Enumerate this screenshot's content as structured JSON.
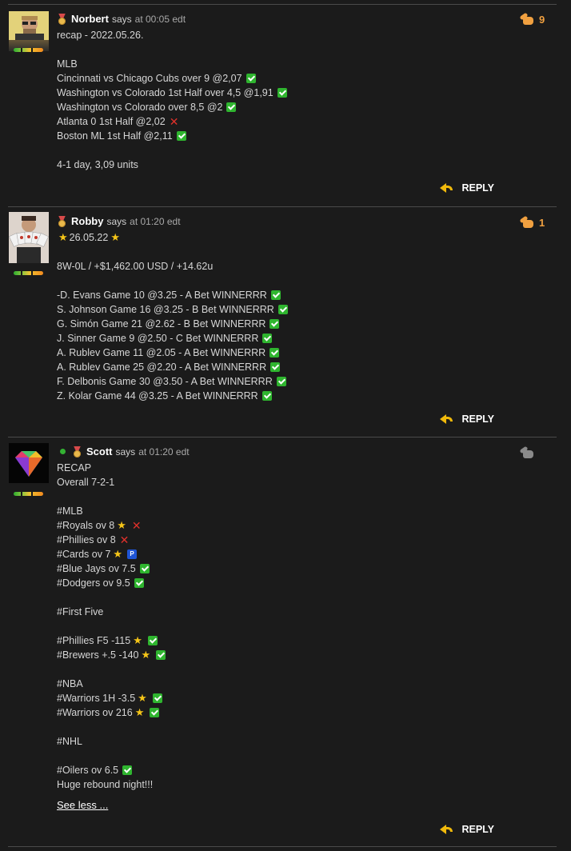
{
  "reply_label": "REPLY",
  "comments": [
    {
      "author": "Norbert",
      "says": "says",
      "time": "at 00:05 edt",
      "likes": "9",
      "lines": [
        {
          "t": "recap - 2022.05.26."
        },
        {
          "t": ""
        },
        {
          "t": "MLB"
        },
        {
          "t": "Cincinnati vs Chicago Cubs over 9 @2,07",
          "m": "check"
        },
        {
          "t": "Washington vs Colorado 1st Half over 4,5 @1,91",
          "m": "check"
        },
        {
          "t": "Washington vs Colorado over 8,5 @2",
          "m": "check"
        },
        {
          "t": "Atlanta 0 1st Half @2,02",
          "m": "cross"
        },
        {
          "t": "Boston ML 1st Half @2,11",
          "m": "check"
        },
        {
          "t": ""
        },
        {
          "t": "4-1 day, 3,09 units"
        }
      ]
    },
    {
      "author": "Robby",
      "says": "says",
      "time": "at 01:20 edt",
      "likes": "1",
      "lines": [
        {
          "t": "26.05.22",
          "m": "starwrap"
        },
        {
          "t": ""
        },
        {
          "t": "8W-0L / +$1,462.00 USD / +14.62u"
        },
        {
          "t": ""
        },
        {
          "t": "-D. Evans Game 10 @3.25 - A Bet WINNERRR",
          "m": "check"
        },
        {
          "t": "S. Johnson Game 16 @3.25 - B Bet WINNERRR",
          "m": "check"
        },
        {
          "t": "G. Simón Game 21 @2.62 - B Bet WINNERRR",
          "m": "check"
        },
        {
          "t": "J. Sinner Game 9 @2.50 - C Bet WINNERRR",
          "m": "check"
        },
        {
          "t": "A. Rublev Game 11 @2.05 - A Bet WINNERRR",
          "m": "check"
        },
        {
          "t": "A. Rublev Game 25 @2.20 - A Bet WINNERRR",
          "m": "check"
        },
        {
          "t": "F. Delbonis Game 30 @3.50 - A Bet WINNERRR",
          "m": "check"
        },
        {
          "t": "Z. Kolar Game 44 @3.25 - A Bet WINNERRR",
          "m": "check"
        }
      ]
    },
    {
      "author": "Scott",
      "says": "says",
      "time": "at 01:20 edt",
      "likes": "",
      "see_less": "See less ...",
      "lines": [
        {
          "t": "RECAP"
        },
        {
          "t": "Overall 7-2-1"
        },
        {
          "t": ""
        },
        {
          "t": "#MLB"
        },
        {
          "t": "#Royals ov 8",
          "m": "star-cross"
        },
        {
          "t": "#Phillies ov 8",
          "m": "cross"
        },
        {
          "t": "#Cards ov 7",
          "m": "star-p"
        },
        {
          "t": "#Blue Jays ov 7.5",
          "m": "check"
        },
        {
          "t": "#Dodgers ov 9.5",
          "m": "check"
        },
        {
          "t": ""
        },
        {
          "t": "#First Five"
        },
        {
          "t": ""
        },
        {
          "t": "#Phillies F5 -115",
          "m": "star-check"
        },
        {
          "t": "#Brewers +.5 -140",
          "m": "star-check"
        },
        {
          "t": ""
        },
        {
          "t": "#NBA"
        },
        {
          "t": "#Warriors 1H -3.5",
          "m": "star-check"
        },
        {
          "t": "#Warriors ov 216",
          "m": "star-check"
        },
        {
          "t": ""
        },
        {
          "t": "#NHL"
        },
        {
          "t": ""
        },
        {
          "t": "#Oilers ov 6.5",
          "m": "check"
        },
        {
          "t": "Huge rebound night!!!"
        }
      ]
    }
  ]
}
